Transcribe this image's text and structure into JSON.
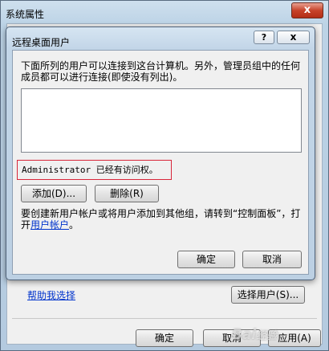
{
  "system_properties": {
    "title": "系统属性",
    "close_label": "x",
    "help_link": "帮助我选择",
    "select_users_label": "选择用户(S)...",
    "ok_label": "确定",
    "cancel_label": "取消",
    "apply_label": "应用(A)"
  },
  "remote_desktop_users": {
    "title": "远程桌面用户",
    "help_label": "?",
    "close_label": "x",
    "description": "下面所列的用户可以连接到这台计算机。另外，管理员组中的任何成员都可以进行连接(即使没有列出)。",
    "users": [],
    "access_note": "Administrator 已经有访问权。",
    "add_label": "添加(D)...",
    "remove_label": "删除(R)",
    "info_prefix": "要创建新用户帐户或将用户添加到其他组，请转到“控制面板”，打开",
    "info_link": "用户帐户",
    "info_suffix": "。",
    "ok_label": "确定",
    "cancel_label": "取消"
  },
  "watermark_text": "Bai经验"
}
